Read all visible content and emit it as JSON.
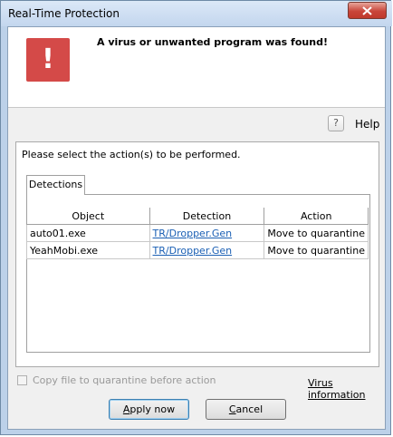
{
  "window": {
    "title": "Real-Time Protection"
  },
  "banner": {
    "icon": "exclamation-icon",
    "icon_glyph": "!",
    "message": "A virus or unwanted program was found!"
  },
  "help": {
    "icon_glyph": "?",
    "label": "Help"
  },
  "panel": {
    "instruction": "Please select the action(s) to be performed.",
    "tab_label": "Detections",
    "columns": [
      "Object",
      "Detection",
      "Action"
    ],
    "rows": [
      {
        "object": "auto01.exe",
        "detection": "TR/Dropper.Gen",
        "action": "Move to quarantine"
      },
      {
        "object": "YeahMobi.exe",
        "detection": "TR/Dropper.Gen",
        "action": "Move to quarantine"
      }
    ]
  },
  "copy_checkbox": {
    "label": "Copy file to quarantine before action",
    "checked": false,
    "enabled": false
  },
  "virus_info_link": "Virus information",
  "buttons": {
    "apply_accel": "A",
    "apply_rest": "pply now",
    "cancel_accel": "C",
    "cancel_rest": "ancel"
  },
  "colors": {
    "alert_red": "#d44a48",
    "link_blue": "#1a5fb4",
    "close_red": "#c9463a"
  }
}
